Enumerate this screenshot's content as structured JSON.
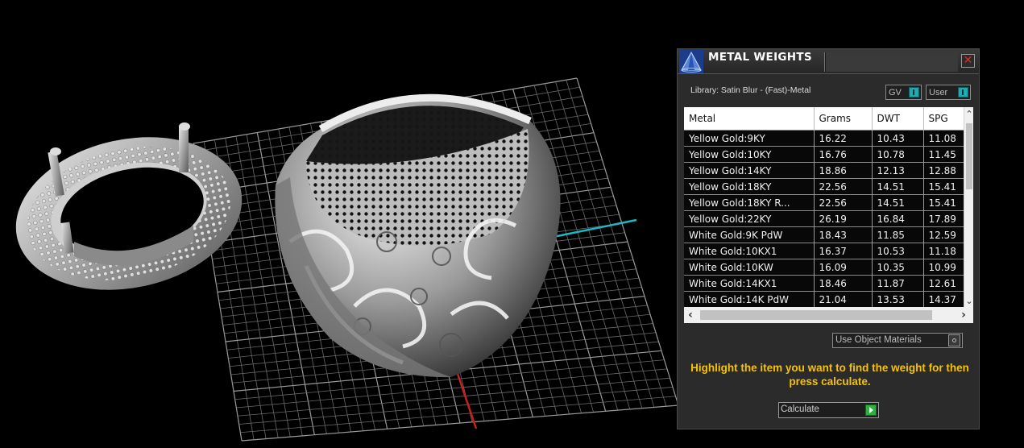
{
  "panel": {
    "title": "METAL WEIGHTS",
    "close_label": "✕",
    "library_label": "Library: Satin Blur - (Fast)-Metal",
    "gv_label": "GV",
    "user_label": "User",
    "use_object_materials_label": "Use Object Materials",
    "hint": "Highlight the item you want to find the weight for then press calculate.",
    "calculate_label": "Calculate"
  },
  "table": {
    "columns": [
      "Metal",
      "Grams",
      "DWT",
      "SPG"
    ],
    "rows": [
      [
        "Yellow Gold:9KY",
        "16.22",
        "10.43",
        "11.08"
      ],
      [
        "Yellow Gold:10KY",
        "16.76",
        "10.78",
        "11.45"
      ],
      [
        "Yellow Gold:14KY",
        "18.86",
        "12.13",
        "12.88"
      ],
      [
        "Yellow Gold:18KY",
        "22.56",
        "14.51",
        "15.41"
      ],
      [
        "Yellow Gold:18KY R...",
        "22.56",
        "14.51",
        "15.41"
      ],
      [
        "Yellow Gold:22KY",
        "26.19",
        "16.84",
        "17.89"
      ],
      [
        "White Gold:9K PdW",
        "18.43",
        "11.85",
        "12.59"
      ],
      [
        "White Gold:10KX1",
        "16.37",
        "10.53",
        "11.18"
      ],
      [
        "White Gold:10KW",
        "16.09",
        "10.35",
        "10.99"
      ],
      [
        "White Gold:14KX1",
        "18.46",
        "11.87",
        "12.61"
      ],
      [
        "White Gold:14K PdW",
        "21.04",
        "13.53",
        "14.37"
      ]
    ]
  },
  "colors": {
    "hint": "#f4c20d",
    "toggle_on": "#1fa9b0",
    "calculate_go": "#2fb040",
    "axis_x": "#1fb7c4",
    "axis_y": "#c8201a"
  },
  "icons": {
    "logo": "pyramid-logo-icon",
    "close": "close-icon",
    "go": "play-icon",
    "scroll_up": "chevron-up-icon",
    "scroll_down": "chevron-down-icon",
    "scroll_left": "chevron-left-icon",
    "scroll_right": "chevron-right-icon"
  }
}
